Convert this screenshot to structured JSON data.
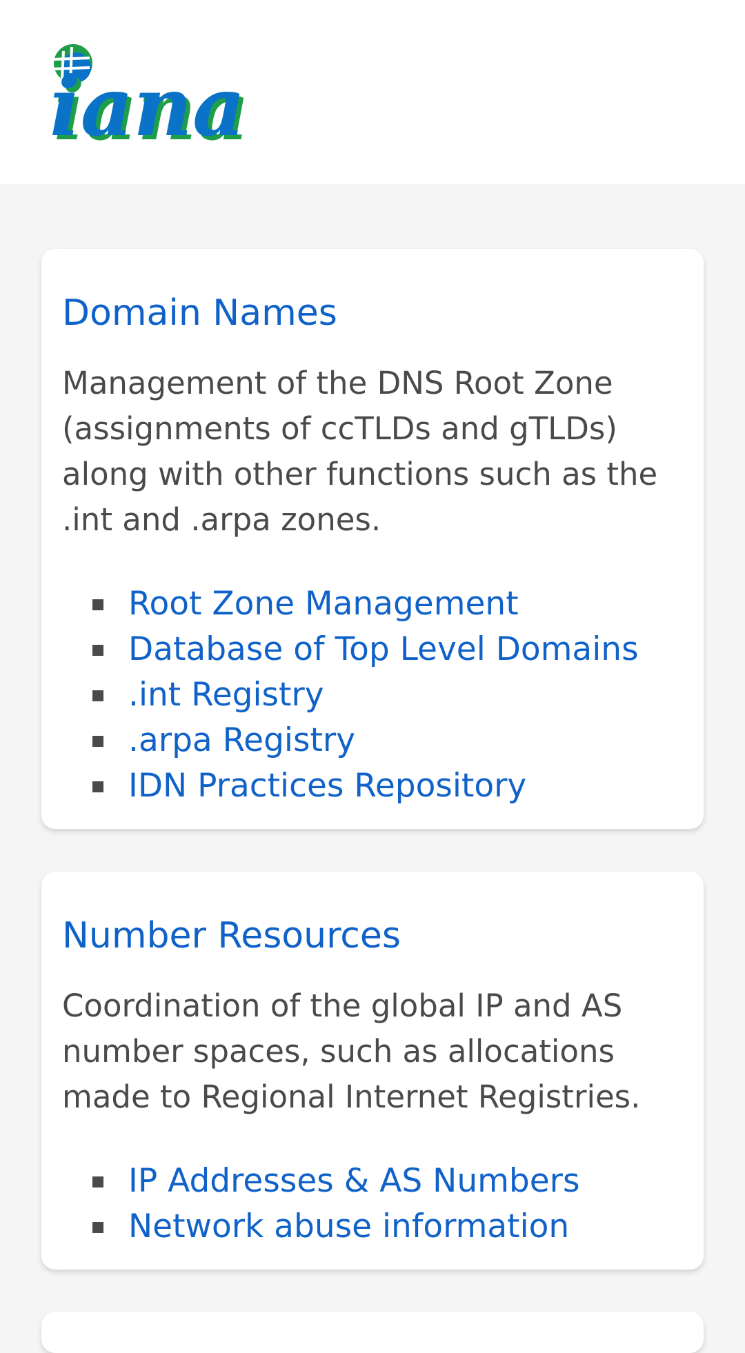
{
  "header": {
    "logo_text": "iana"
  },
  "colors": {
    "link": "#1062c9",
    "text": "#4a4a4a",
    "logo_blue": "#0a73c7",
    "logo_green": "#1f9e4a"
  },
  "sections": [
    {
      "title": "Domain Names",
      "description": [
        "Management of the DNS Root Zone",
        "(assignments of ccTLDs and gTLDs)",
        "along with other functions such as the",
        ".int and .arpa zones."
      ],
      "links": [
        "Root Zone Management",
        "Database of Top Level Domains",
        ".int Registry",
        ".arpa Registry",
        "IDN Practices Repository"
      ]
    },
    {
      "title": "Number Resources",
      "description": [
        "Coordination of the global IP and AS",
        "number spaces, such as allocations",
        "made to Regional Internet Registries."
      ],
      "links": [
        "IP Addresses & AS Numbers",
        "Network abuse information"
      ]
    }
  ]
}
